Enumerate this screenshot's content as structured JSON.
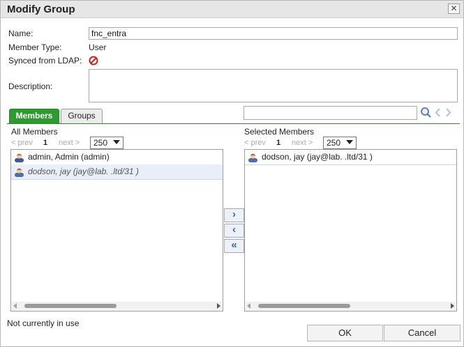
{
  "dialog": {
    "title": "Modify Group",
    "close_label": "✕"
  },
  "form": {
    "name_label": "Name:",
    "name_value": "fnc_entra",
    "member_type_label": "Member Type:",
    "member_type_value": "User",
    "synced_label": "Synced from LDAP:",
    "synced_icon": "prohibited-icon",
    "description_label": "Description:",
    "description_value": ""
  },
  "tabs": {
    "members": "Members",
    "groups": "Groups"
  },
  "search": {
    "value": "",
    "icons": [
      "search-icon",
      "chevron-left-icon",
      "chevron-right-icon"
    ]
  },
  "all_members": {
    "heading": "All Members",
    "prev": "< prev",
    "page": "1",
    "next": "next >",
    "page_size": "250",
    "rows": [
      {
        "label": "admin, Admin (admin)"
      },
      {
        "label": "dodson, jay (jay@lab.          .ltd/31                           )"
      }
    ]
  },
  "selected_members": {
    "heading": "Selected Members",
    "prev": "< prev",
    "page": "1",
    "next": "next >",
    "page_size": "250",
    "rows": [
      {
        "label": "dodson, jay (jay@lab.            .ltd/31                           )"
      }
    ]
  },
  "move_buttons": {
    "add": "›",
    "remove": "‹",
    "remove_all": "«"
  },
  "status": "Not currently in use",
  "actions": {
    "ok": "OK",
    "cancel": "Cancel"
  },
  "colors": {
    "accent": "#2f9a2f",
    "selection": "#e9eef8",
    "icon_blue": "#6b8fc4",
    "prohibited": "#d02020"
  }
}
